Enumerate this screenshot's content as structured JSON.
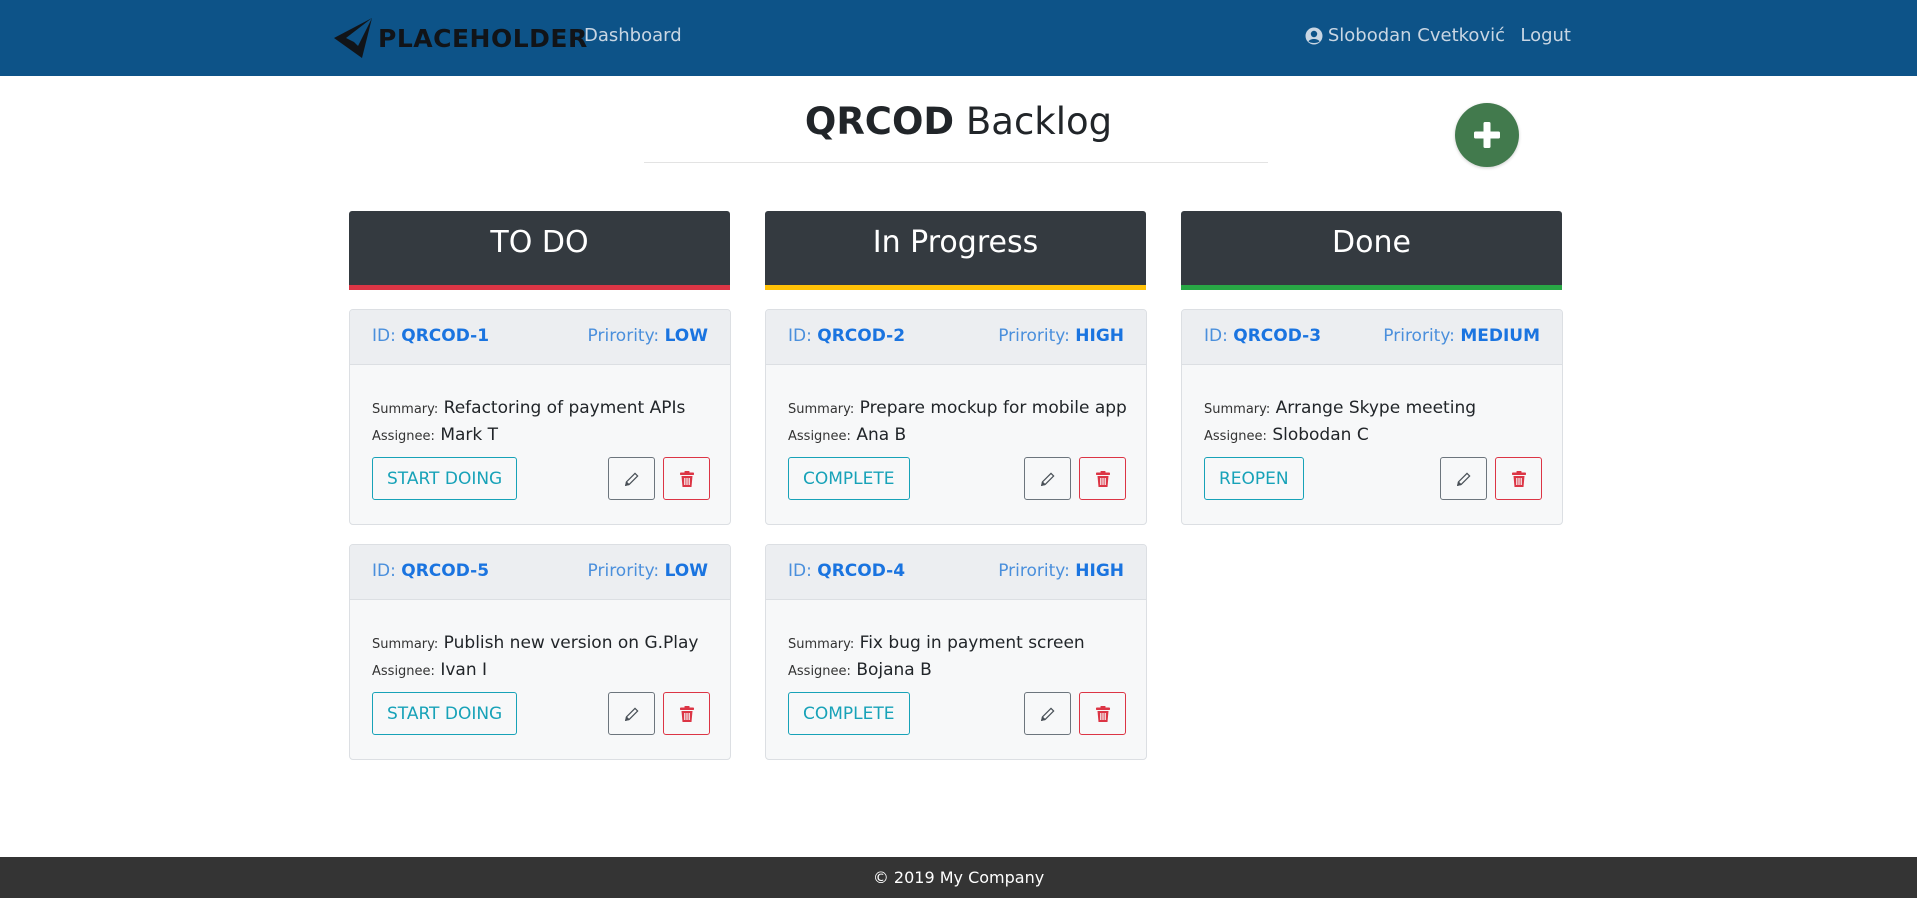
{
  "navbar": {
    "brand": "PLACEHOLDER",
    "dashboard_link": "Dashboard",
    "user_name": "Slobodan Cvetković",
    "logout_link": "Logut"
  },
  "page": {
    "project_key": "QRCOD",
    "title_suffix": "Backlog",
    "add_button_icon": "plus-icon"
  },
  "columns": [
    {
      "title": "TO DO",
      "accent": "#dc3545"
    },
    {
      "title": "In Progress",
      "accent": "#ffc107"
    },
    {
      "title": "Done",
      "accent": "#28a745"
    }
  ],
  "labels": {
    "id": "ID:",
    "priority": "Prirority:",
    "summary": "Summary:",
    "assignee": "Assignee:"
  },
  "cards": [
    {
      "id": "QRCOD-1",
      "priority": "LOW",
      "summary": "Refactoring of payment APIs",
      "assignee": "Mark T",
      "action": "START DOING"
    },
    {
      "id": "QRCOD-5",
      "priority": "LOW",
      "summary": "Publish new version on G.Play",
      "assignee": "Ivan I",
      "action": "START DOING"
    },
    {
      "id": "QRCOD-2",
      "priority": "HIGH",
      "summary": "Prepare mockup for mobile app",
      "assignee": "Ana B",
      "action": "COMPLETE"
    },
    {
      "id": "QRCOD-4",
      "priority": "HIGH",
      "summary": "Fix bug in payment screen",
      "assignee": "Bojana B",
      "action": "COMPLETE"
    },
    {
      "id": "QRCOD-3",
      "priority": "MEDIUM",
      "summary": "Arrange Skype meeting",
      "assignee": "Slobodan C",
      "action": "REOPEN"
    }
  ],
  "colors": {
    "navbar": "#0d5388",
    "column_header": "#343a40",
    "link_blue": "#1a74e0",
    "action_teal": "#17a2b8",
    "delete_red": "#dc3545",
    "add_green": "#427a4d",
    "footer": "#343434"
  },
  "footer": {
    "text": "© 2019 My Company"
  }
}
